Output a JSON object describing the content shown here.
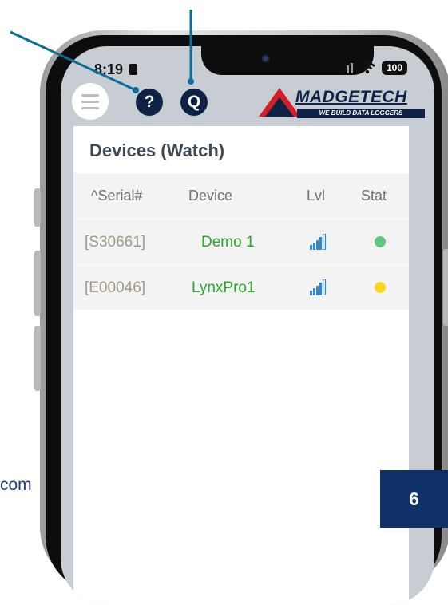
{
  "status_bar": {
    "time": "8:19",
    "battery": "100"
  },
  "header": {
    "help_icon_glyph": "?",
    "q_icon_glyph": "Q",
    "logo_name": "MADGETECH",
    "logo_tagline": "WE BUILD DATA LOGGERS"
  },
  "panel": {
    "title": "Devices (Watch)",
    "columns": {
      "serial": "^Serial#",
      "device": "Device",
      "level": "Lvl",
      "status": "Stat"
    },
    "rows": [
      {
        "serial": "[S30661]",
        "device": "Demo 1",
        "level_icon": "signal-bars-icon",
        "status_color": "#5cc97c"
      },
      {
        "serial": "[E00046]",
        "device": "LynxPro1",
        "level_icon": "signal-bars-icon",
        "status_color": "#f9d71c"
      }
    ]
  },
  "page": {
    "footer_fragment": "com",
    "page_number": "6"
  },
  "colors": {
    "accent_navy": "#0d2244",
    "logo_red": "#d32027",
    "device_green": "#2aa72a",
    "signal_blue": "#2e88d6"
  }
}
